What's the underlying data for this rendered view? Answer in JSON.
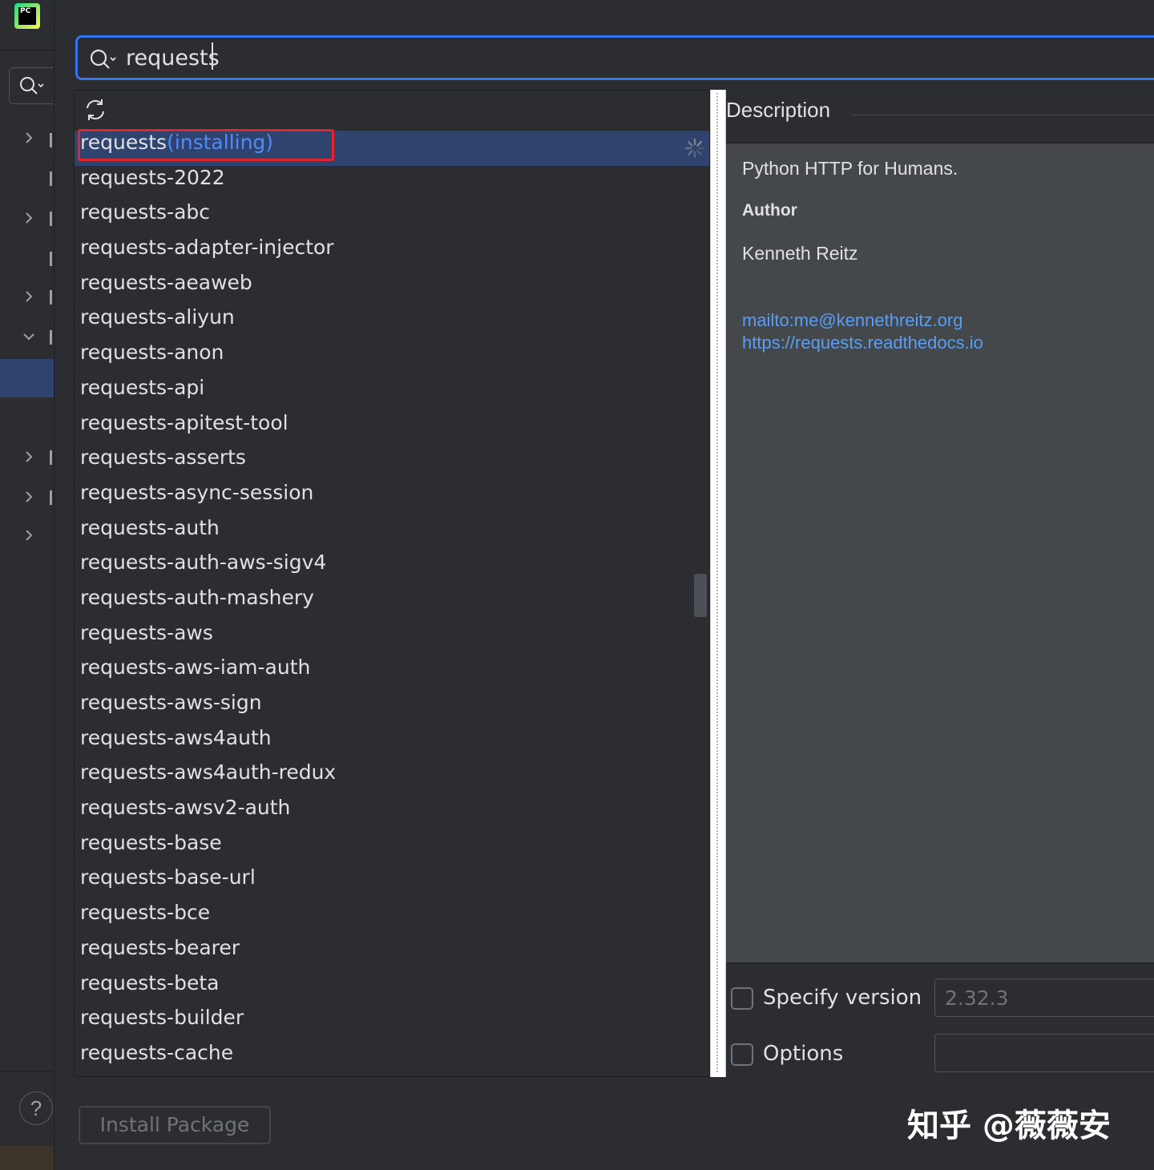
{
  "app": {
    "logo_text": "PC"
  },
  "search": {
    "query": "requests"
  },
  "packages": [
    {
      "name": "requests",
      "status": "(installing)"
    },
    {
      "name": "requests-2022"
    },
    {
      "name": "requests-abc"
    },
    {
      "name": "requests-adapter-injector"
    },
    {
      "name": "requests-aeaweb"
    },
    {
      "name": "requests-aliyun"
    },
    {
      "name": "requests-anon"
    },
    {
      "name": "requests-api"
    },
    {
      "name": "requests-apitest-tool"
    },
    {
      "name": "requests-asserts"
    },
    {
      "name": "requests-async-session"
    },
    {
      "name": "requests-auth"
    },
    {
      "name": "requests-auth-aws-sigv4"
    },
    {
      "name": "requests-auth-mashery"
    },
    {
      "name": "requests-aws"
    },
    {
      "name": "requests-aws-iam-auth"
    },
    {
      "name": "requests-aws-sign"
    },
    {
      "name": "requests-aws4auth"
    },
    {
      "name": "requests-aws4auth-redux"
    },
    {
      "name": "requests-awsv2-auth"
    },
    {
      "name": "requests-base"
    },
    {
      "name": "requests-base-url"
    },
    {
      "name": "requests-bce"
    },
    {
      "name": "requests-bearer"
    },
    {
      "name": "requests-beta"
    },
    {
      "name": "requests-builder"
    },
    {
      "name": "requests-cache"
    }
  ],
  "description": {
    "title": "Description",
    "summary": "Python HTTP for Humans.",
    "author_label": "Author",
    "author": "Kenneth Reitz",
    "links": [
      "mailto:me@kennethreitz.org",
      "https://requests.readthedocs.io"
    ]
  },
  "options": {
    "specify_version_label": "Specify version",
    "version_value": "2.32.3",
    "options_label": "Options",
    "options_value": ""
  },
  "install_button": "Install Package",
  "watermark": "知乎 @薇薇安",
  "help_label": "?",
  "colors": {
    "accent": "#3574f0",
    "selection": "#2e436e",
    "installing": "#548af7",
    "highlight_box": "#e0262c",
    "link": "#589df6"
  },
  "icons": {
    "search": "search-icon",
    "refresh": "refresh-icon",
    "spinner": "loading-spinner-icon",
    "chevron": "chevron-right-icon"
  }
}
